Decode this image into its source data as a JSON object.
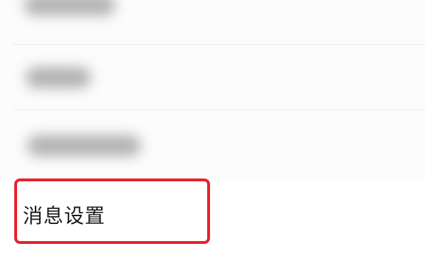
{
  "settings_list": {
    "items": [
      {
        "label": "",
        "blurred": true
      },
      {
        "label": "",
        "blurred": true
      },
      {
        "label": "",
        "blurred": true
      },
      {
        "label": "消息设置",
        "blurred": false
      }
    ]
  },
  "annotation": {
    "highlight_color": "#e8212a",
    "highlighted_item": "消息设置"
  }
}
